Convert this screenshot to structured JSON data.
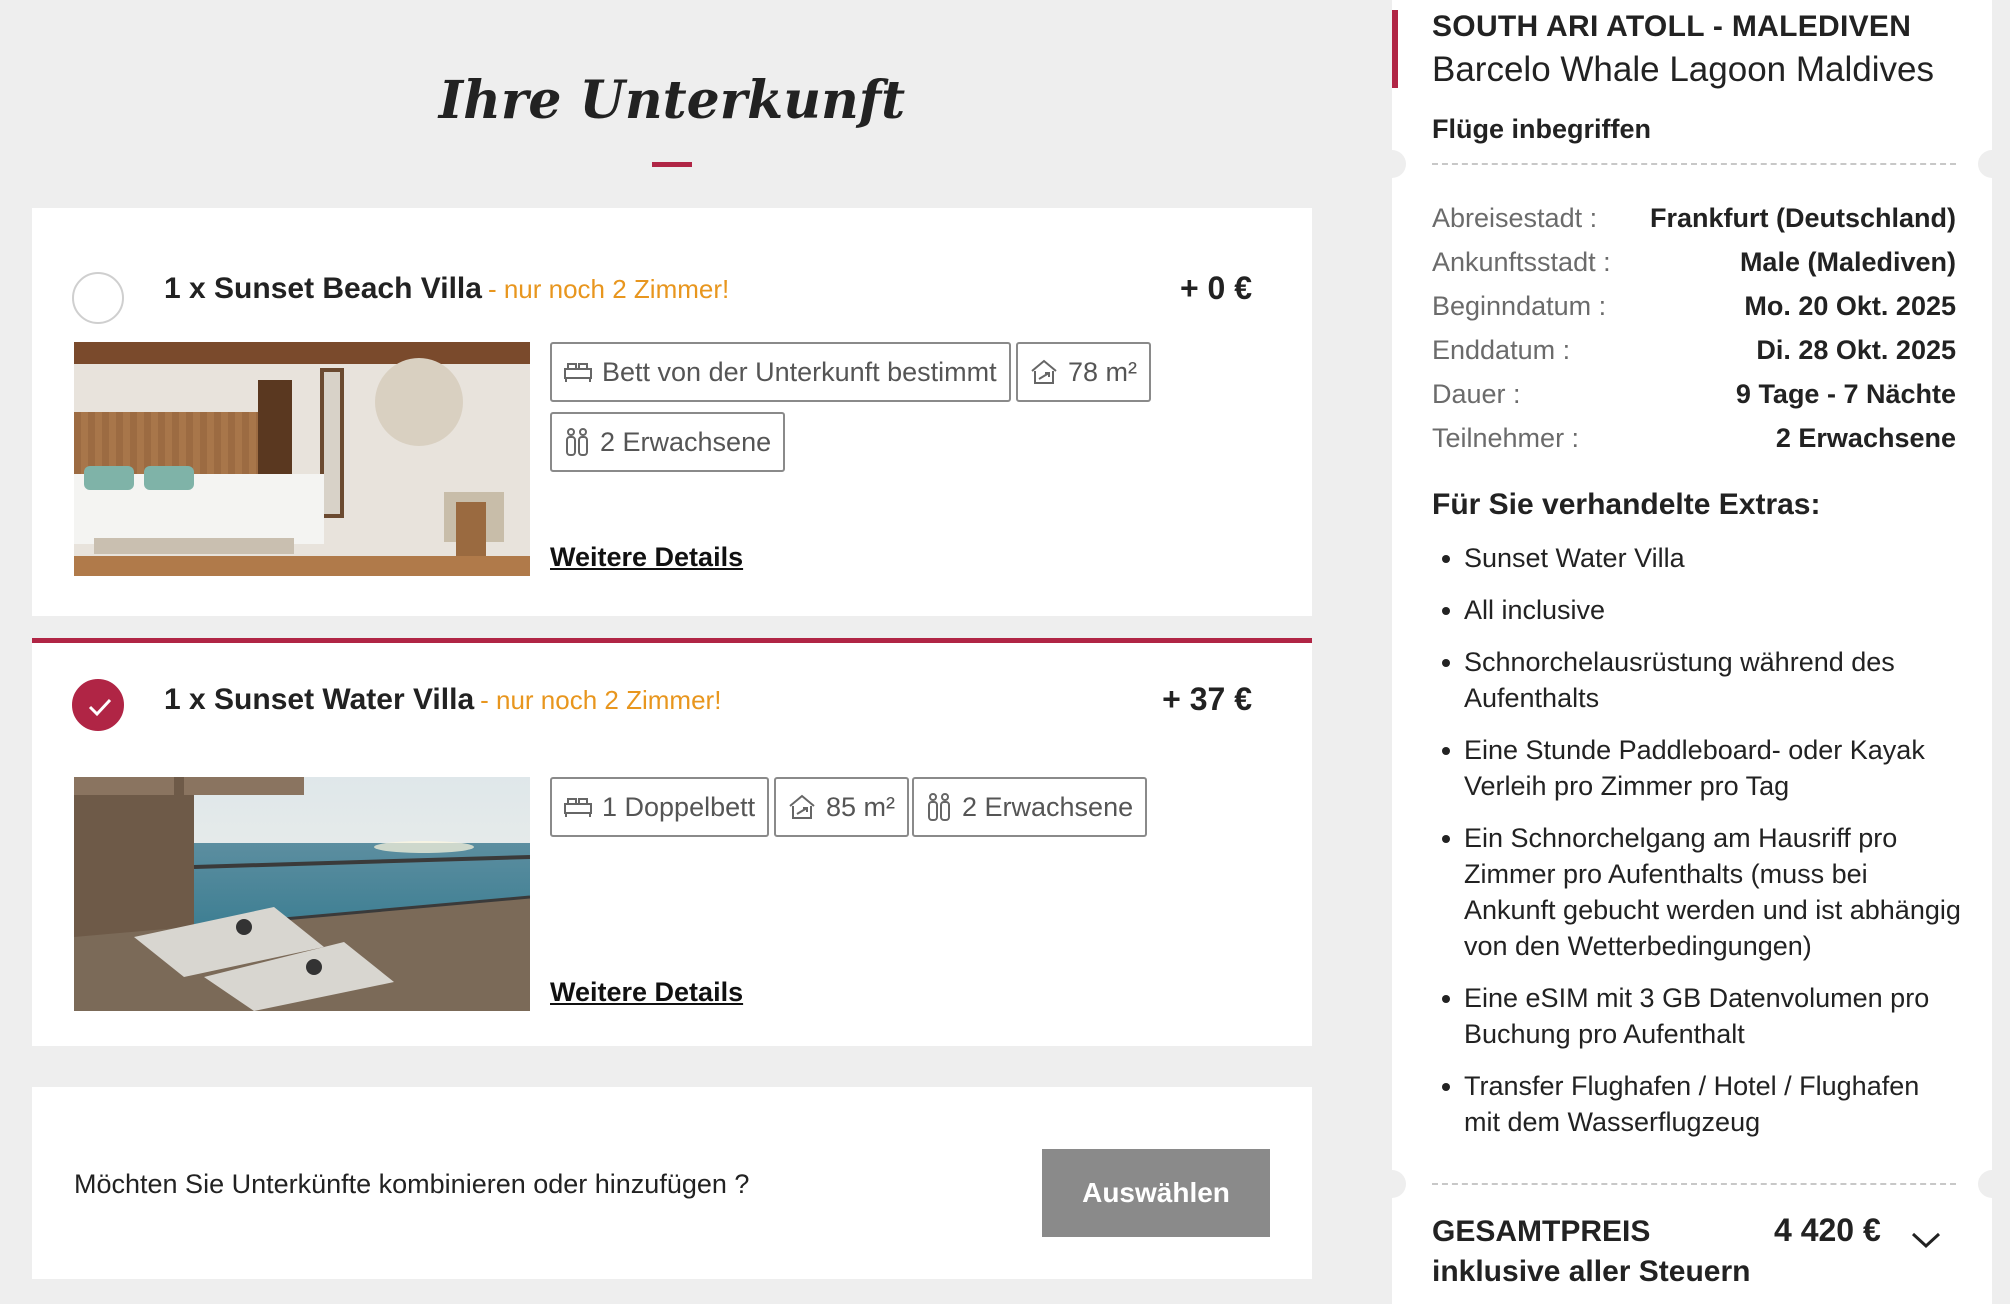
{
  "page": {
    "title": "Ihre Unterkunft"
  },
  "rooms": [
    {
      "name": "1 x Sunset Beach Villa",
      "availability": "- nur noch 2 Zimmer!",
      "price": "+ 0 €",
      "selected": false,
      "chips": [
        "Bett von der Unterkunft bestimmt",
        "78 m²",
        "2 Erwachsene"
      ],
      "details_label": "Weitere Details"
    },
    {
      "name": "1 x Sunset Water Villa",
      "availability": "- nur noch 2 Zimmer!",
      "price": "+ 37 €",
      "selected": true,
      "chips": [
        "1 Doppelbett",
        "85 m²",
        "2 Erwachsene"
      ],
      "details_label": "Weitere Details"
    }
  ],
  "combine": {
    "question": "Möchten Sie Unterkünfte kombinieren oder hinzufügen ?",
    "button_label": "Auswählen"
  },
  "summary": {
    "destination": "SOUTH ARI ATOLL - MALEDIVEN",
    "hotel": "Barcelo Whale Lagoon Maldives",
    "flights": "Flüge inbegriffen",
    "info": [
      {
        "label": "Abreisestadt :",
        "value": "Frankfurt (Deutschland)"
      },
      {
        "label": "Ankunftsstadt :",
        "value": "Male (Malediven)"
      },
      {
        "label": "Beginndatum :",
        "value": "Mo. 20 Okt. 2025"
      },
      {
        "label": "Enddatum :",
        "value": "Di. 28 Okt. 2025"
      },
      {
        "label": "Dauer :",
        "value": "9 Tage - 7 Nächte"
      },
      {
        "label": "Teilnehmer :",
        "value": "2 Erwachsene"
      }
    ],
    "extras_title": "Für Sie verhandelte Extras:",
    "extras": [
      "Sunset Water Villa",
      "All inclusive",
      "Schnorchelausrüstung während des Aufenthalts",
      "Eine Stunde Paddleboard- oder Kayak Verleih pro Zimmer pro Tag",
      "Ein Schnorchelgang am Hausriff pro Zimmer pro Aufenthalts (muss bei Ankunft gebucht werden und ist abhängig von den Wetterbedingungen)",
      "Eine eSIM mit 3 GB Datenvolumen pro Buchung pro Aufenthalt",
      "Transfer Flughafen / Hotel / Flughafen mit dem Wasserflugzeug"
    ],
    "total_label": "GESAMTPREIS inklusive aller Steuern",
    "total_price": "4 420 €"
  },
  "colors": {
    "accent": "#b02545",
    "availability": "#e8961e",
    "background": "#eeeeee",
    "button": "#8a8a8a"
  },
  "icons": {
    "bed": "bed-icon",
    "area": "area-icon",
    "people": "people-icon",
    "check": "check-icon",
    "chevron": "chevron-down-icon"
  }
}
